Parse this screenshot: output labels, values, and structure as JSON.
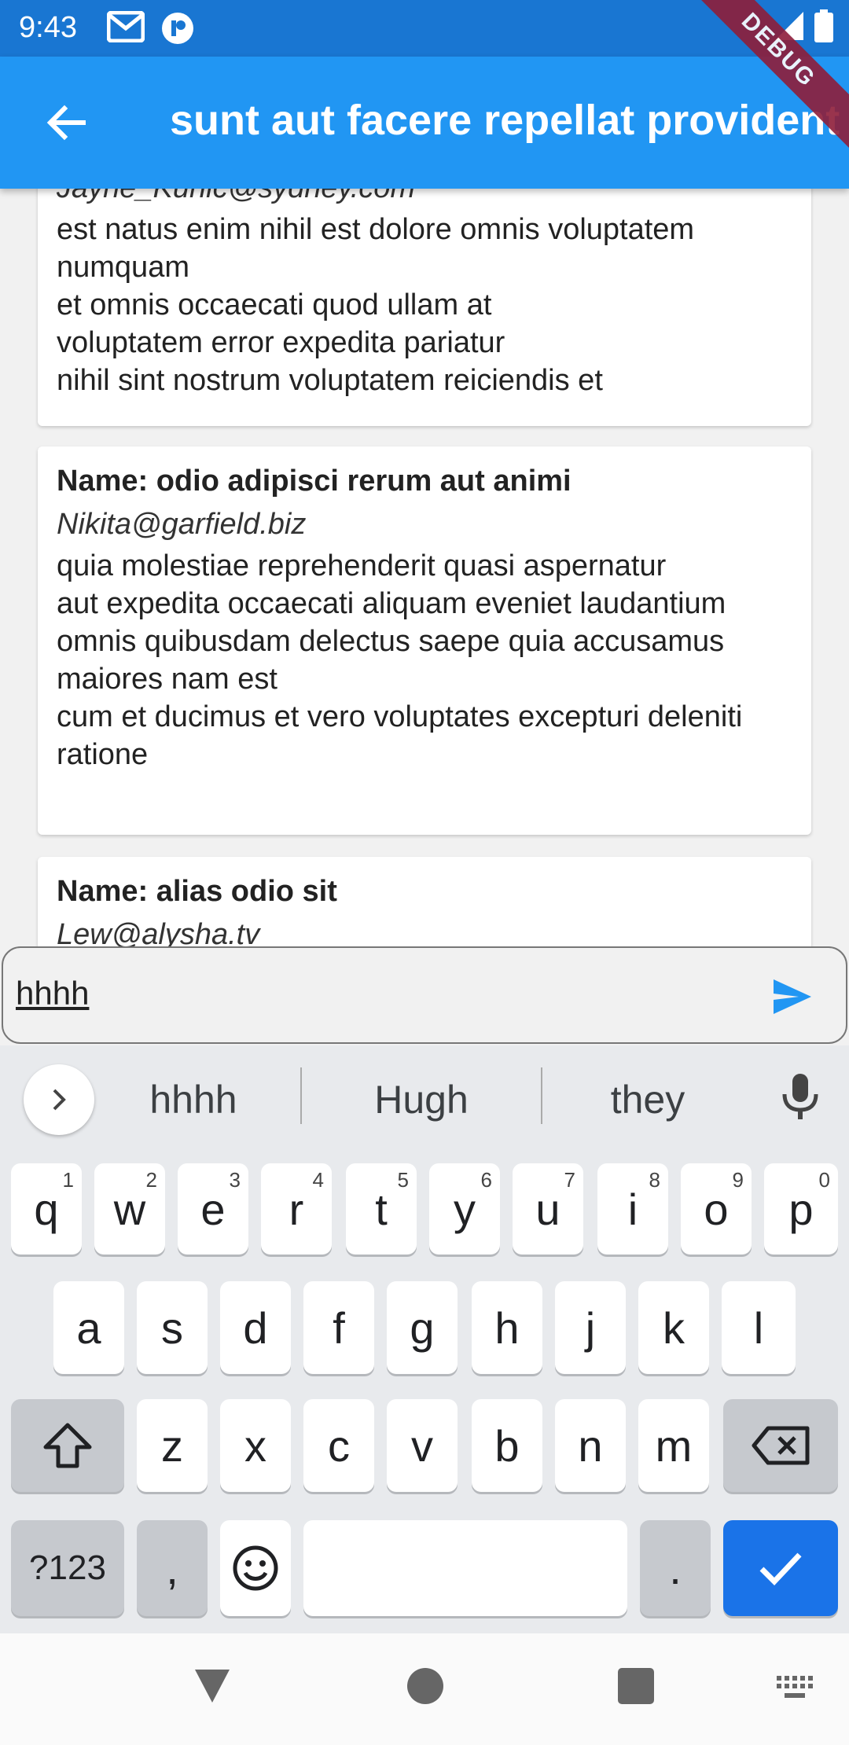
{
  "status_bar": {
    "time": "9:43",
    "icons": [
      "gmail-icon",
      "app-notification-icon",
      "signal-icon",
      "battery-icon"
    ]
  },
  "debug_banner": "DEBUG",
  "app_bar": {
    "back_icon": "arrow-back-icon",
    "title": "sunt aut facere repellat provident"
  },
  "comments": [
    {
      "name": "",
      "email": "Jayne_Kuhic@sydney.com",
      "body": "est natus enim nihil est dolore omnis voluptatem numquam\net omnis occaecati quod ullam at\nvoluptatem error expedita pariatur\nnihil sint nostrum voluptatem reiciendis et"
    },
    {
      "name": "Name: odio adipisci rerum aut animi",
      "email": "Nikita@garfield.biz",
      "body": "quia molestiae reprehenderit quasi aspernatur\naut expedita occaecati aliquam eveniet laudantium\nomnis quibusdam delectus saepe quia accusamus maiores nam est\ncum et ducimus et vero voluptates excepturi deleniti ratione"
    },
    {
      "name": "Name: alias odio sit",
      "email": "Lew@alysha.tv",
      "body": ""
    }
  ],
  "input": {
    "value": "hhhh",
    "send_icon": "send-icon"
  },
  "keyboard": {
    "suggestions": [
      "hhhh",
      "Hugh",
      "they"
    ],
    "row1": [
      {
        "k": "q",
        "n": "1"
      },
      {
        "k": "w",
        "n": "2"
      },
      {
        "k": "e",
        "n": "3"
      },
      {
        "k": "r",
        "n": "4"
      },
      {
        "k": "t",
        "n": "5"
      },
      {
        "k": "y",
        "n": "6"
      },
      {
        "k": "u",
        "n": "7"
      },
      {
        "k": "i",
        "n": "8"
      },
      {
        "k": "o",
        "n": "9"
      },
      {
        "k": "p",
        "n": "0"
      }
    ],
    "row2": [
      "a",
      "s",
      "d",
      "f",
      "g",
      "h",
      "j",
      "k",
      "l"
    ],
    "row3": [
      "z",
      "x",
      "c",
      "v",
      "b",
      "n",
      "m"
    ],
    "symbols_key": "?123",
    "comma_key": ",",
    "period_key": ".",
    "accent_color": "#1a73e8"
  },
  "nav_bar": {
    "icons": [
      "nav-back-icon",
      "nav-home-icon",
      "nav-recents-icon",
      "keyboard-switch-icon"
    ]
  }
}
